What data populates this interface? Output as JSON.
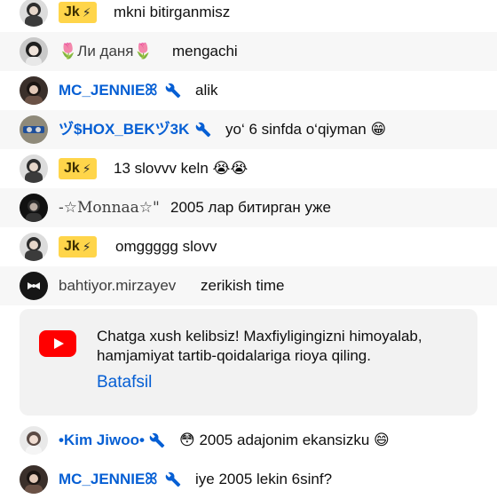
{
  "messages": [
    {
      "author": "Jk",
      "badge_icon": "⚡",
      "text": "mkni bitirganmisz"
    },
    {
      "author": "🌷Ли даня🌷",
      "text": "mengachi"
    },
    {
      "author": "MC_JENNIEꕤ",
      "text": "alik"
    },
    {
      "author": "ヅ$HOX_BEKヅ3K",
      "text": "yo‘ 6 sinfda o‘qiyman 😁"
    },
    {
      "author": "Jk",
      "badge_icon": "⚡",
      "text": "13 slovvv keln 😭😭"
    },
    {
      "author": "-☆Monnaa☆\"",
      "text": "2005 лар битирган уже"
    },
    {
      "author": "Jk",
      "badge_icon": "⚡",
      "text": "omggggg slovv"
    },
    {
      "author": "bahtiyor.mirzayev",
      "text": "zerikish time"
    },
    {
      "author": "•Kim Jiwoo•",
      "text": "😳 2005 adajonim ekansizku 😄"
    },
    {
      "author": "MC_JENNIEꕤ",
      "text": "iye 2005 lekin 6sinf?"
    }
  ],
  "welcome_card": {
    "text": "Chatga xush kelibsiz! Maxfiyligingizni himoyalab, hamjamiyat tartib-qoidalariga rioya qiling.",
    "link_label": "Batafsil"
  },
  "icons": {
    "moderator": "wrench-icon",
    "youtube": "youtube-logo-icon",
    "member_badge": "lightning-icon"
  },
  "colors": {
    "moderator_blue": "#065fd4",
    "member_badge_bg": "#ffd54a",
    "youtube_red": "#ff0000",
    "card_bg": "#f2f2f2"
  }
}
